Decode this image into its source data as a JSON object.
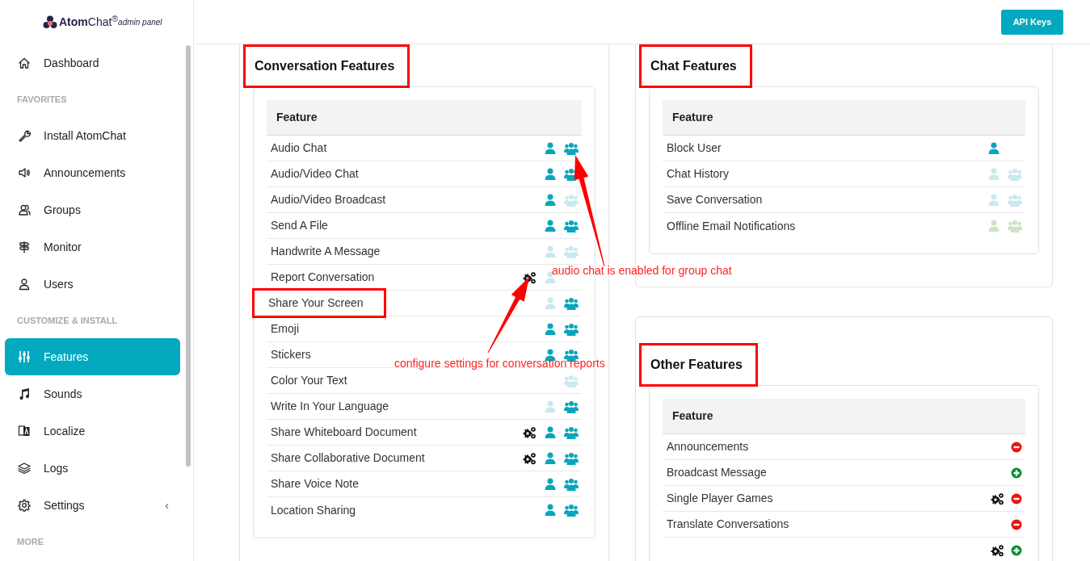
{
  "logo": {
    "text": "**Atom**Chat$^{®}$",
    "tagline": "admin panel"
  },
  "header": {
    "button": "API Keys"
  },
  "sidebar": {
    "items": [
      {
        "kind": "link",
        "label": "Dashboard",
        "selected": false
      },
      {
        "kind": "section",
        "label": "FAVORITES"
      },
      {
        "kind": "link",
        "label": "Install AtomChat",
        "selected": false
      },
      {
        "kind": "link",
        "label": "Announcements",
        "selected": false
      },
      {
        "kind": "link",
        "label": "Groups",
        "selected": false
      },
      {
        "kind": "link",
        "label": "Monitor",
        "selected": false
      },
      {
        "kind": "link",
        "label": "Users",
        "selected": false
      },
      {
        "kind": "section",
        "label": "CUSTOMIZE & INSTALL"
      },
      {
        "kind": "link",
        "label": "Features",
        "selected": true
      },
      {
        "kind": "link",
        "label": "Sounds",
        "selected": false
      },
      {
        "kind": "link",
        "label": "Localize",
        "selected": false
      },
      {
        "kind": "link",
        "label": "Logs",
        "selected": false
      },
      {
        "kind": "link",
        "label": "Settings",
        "selected": false,
        "caret": "‹"
      },
      {
        "kind": "section",
        "label": "MORE"
      }
    ]
  },
  "panels": [
    {
      "title": "Conversation Features",
      "highlighted": true,
      "kind": "access",
      "column": "Feature",
      "rows": [
        {
          "name": "Audio Chat",
          "highlighted": false,
          "settings": false,
          "user_enabled": true,
          "group_enabled": true
        },
        {
          "name": "Audio/Video Chat",
          "highlighted": false,
          "settings": false,
          "user_enabled": true,
          "group_enabled": true
        },
        {
          "name": "Audio/Video Broadcast",
          "highlighted": false,
          "settings": false,
          "user_enabled": true,
          "group_enabled": false
        },
        {
          "name": "Send A File",
          "highlighted": false,
          "settings": false,
          "user_enabled": true,
          "group_enabled": true
        },
        {
          "name": "Handwrite A Message",
          "highlighted": false,
          "settings": false,
          "user_enabled": false,
          "group_enabled": false
        },
        {
          "name": "Report Conversation",
          "highlighted": false,
          "settings": true,
          "user_enabled": false
        },
        {
          "name": "Share Your Screen",
          "highlighted": true,
          "settings": false,
          "user_enabled": false,
          "group_enabled": true
        },
        {
          "name": "Emoji",
          "highlighted": false,
          "settings": false,
          "user_enabled": true,
          "group_enabled": true
        },
        {
          "name": "Stickers",
          "highlighted": false,
          "settings": false,
          "user_enabled": true,
          "group_enabled": true
        },
        {
          "name": "Color Your Text",
          "highlighted": false,
          "settings": false,
          "group_enabled": false
        },
        {
          "name": "Write In Your Language",
          "highlighted": false,
          "settings": false,
          "user_enabled": false,
          "group_enabled": true
        },
        {
          "name": "Share Whiteboard Document",
          "highlighted": false,
          "settings": true,
          "user_enabled": true,
          "group_enabled": true
        },
        {
          "name": "Share Collaborative Document",
          "highlighted": false,
          "settings": true,
          "user_enabled": true,
          "group_enabled": true
        },
        {
          "name": "Share Voice Note",
          "highlighted": false,
          "settings": false,
          "user_enabled": true,
          "group_enabled": true
        },
        {
          "name": "Location Sharing",
          "highlighted": false,
          "settings": false,
          "user_enabled": true,
          "group_enabled": true
        }
      ]
    },
    {
      "title": "Chat Features",
      "highlighted": true,
      "kind": "access",
      "column": "Feature",
      "rows": [
        {
          "name": "Block User",
          "highlighted": false,
          "settings": false,
          "available": true,
          "user_enabled": true
        },
        {
          "name": "Chat History",
          "highlighted": false,
          "settings": false,
          "available": true,
          "user_enabled": false,
          "group_enabled": false
        },
        {
          "name": "Save Conversation",
          "highlighted": false,
          "settings": false,
          "available": true,
          "user_enabled": false,
          "group_enabled": false
        },
        {
          "name": "Offline Email Notifications",
          "highlighted": false,
          "settings": false,
          "available": false
        }
      ]
    },
    {
      "title": "Other Features",
      "highlighted": true,
      "kind": "toggle",
      "column": "Feature",
      "rows": [
        {
          "name": "Announcements",
          "settings": false,
          "enabled": false
        },
        {
          "name": "Broadcast Message",
          "settings": false,
          "enabled": true
        },
        {
          "name": "Single Player Games",
          "settings": true,
          "enabled": false
        },
        {
          "name": "Translate Conversations",
          "settings": false,
          "enabled": false
        },
        {
          "settings": true,
          "enabled": true
        }
      ]
    }
  ],
  "annotations": [
    {
      "text": "audio chat is enabled for group chat"
    },
    {
      "text": "configure settings for conversation reports"
    }
  ]
}
